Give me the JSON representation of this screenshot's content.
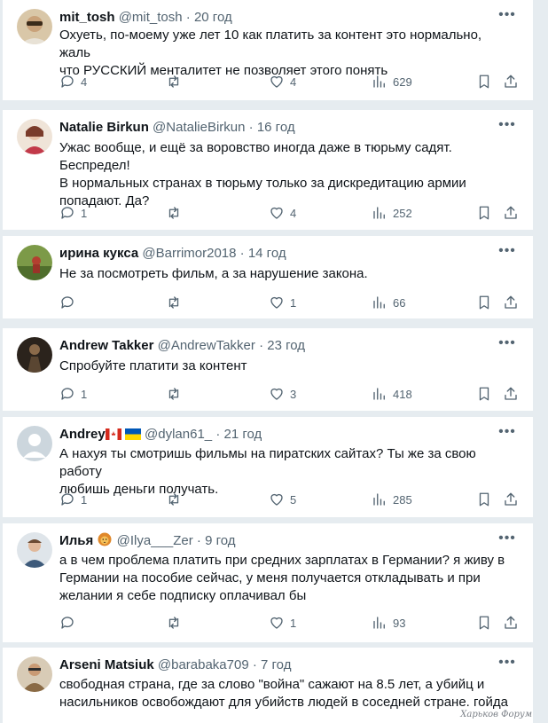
{
  "tweets": [
    {
      "name": "mit_tosh",
      "handle": "@mit_tosh",
      "time": "20 год",
      "text_lines": [
        "Охуеть, по-моему уже лет 10 как платить за контент это нормально, жаль",
        "что РУССКИЙ менталитет не позволяет этого понять"
      ],
      "replies": "4",
      "retweets": "",
      "likes": "4",
      "views": "629",
      "avatar_color": "#c9a27a"
    },
    {
      "name": "Natalie Birkun",
      "handle": "@NatalieBirkun",
      "time": "16 год",
      "text_lines": [
        "Ужас вообще, и ещё за воровство иногда даже в тюрьму садят. Беспредел!",
        "В нормальных странах в тюрьму только за дискредитацию армии",
        "попадают. Да?"
      ],
      "replies": "1",
      "retweets": "",
      "likes": "4",
      "views": "252",
      "avatar_color": "#b34a4a"
    },
    {
      "name": "ирина кукса",
      "handle": "@Barrimor2018",
      "time": "14 год",
      "text_lines": [
        "Не за посмотреть фильм, а за нарушение закона."
      ],
      "replies": "",
      "retweets": "",
      "likes": "1",
      "views": "66",
      "avatar_color": "#6e8a3e"
    },
    {
      "name": "Andrew Takker",
      "handle": "@AndrewTakker",
      "time": "23 год",
      "text_lines": [
        "Спробуйте платити за контент"
      ],
      "replies": "1",
      "retweets": "",
      "likes": "3",
      "views": "418",
      "avatar_color": "#3a2f25"
    },
    {
      "name": "Andrey",
      "handle": "@dylan61_",
      "time": "21 год",
      "text_lines": [
        "А нахуя ты смотришь фильмы на пиратских сайтах?  Ты же за свою работу",
        "любишь деньги получать."
      ],
      "replies": "1",
      "retweets": "",
      "likes": "5",
      "views": "285",
      "avatar_color": "#c4cfd6"
    },
    {
      "name": "Илья",
      "handle": "@Ilya___Zer",
      "time": "9 год",
      "text_lines": [
        "а в чем проблема платить при средних зарплатах в Германии? я живу в",
        "Германии на пособие сейчас, у меня получается откладывать и при",
        "желании я себе подписку оплачивал бы"
      ],
      "replies": "",
      "retweets": "",
      "likes": "1",
      "views": "93",
      "avatar_color": "#7d8fa6"
    },
    {
      "name": "Arseni Matsiuk",
      "handle": "@barabaka709",
      "time": "7 год",
      "text_lines": [
        "свободная страна, где за слово \"война\" сажают на 8.5 лет, а убийц и",
        "насильников освобождают для убийств людей в соседней стране. гойда"
      ],
      "replies": "",
      "retweets": "",
      "likes": "",
      "views": "",
      "avatar_color": "#9c7a52"
    }
  ],
  "dot": "·",
  "more": "•••",
  "watermark": "Харьков Форум"
}
